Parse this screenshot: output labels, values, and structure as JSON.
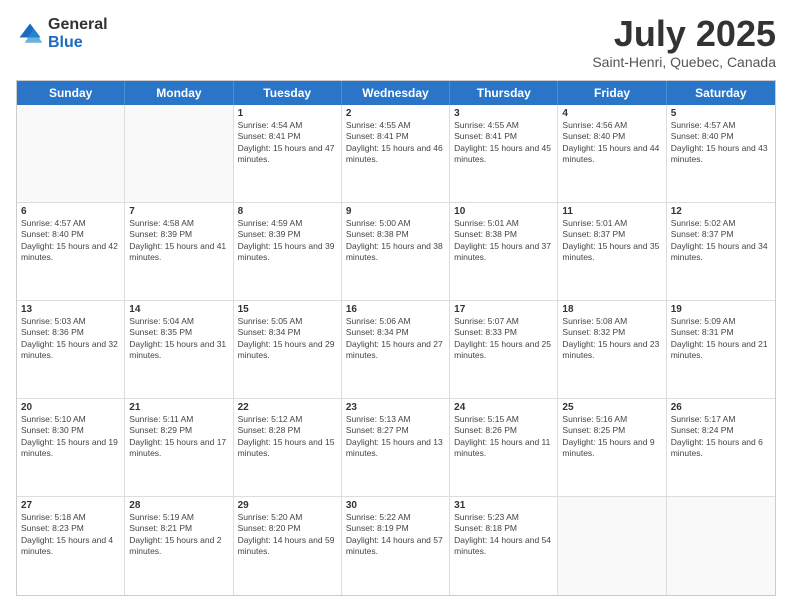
{
  "logo": {
    "general": "General",
    "blue": "Blue"
  },
  "title": "July 2025",
  "location": "Saint-Henri, Quebec, Canada",
  "header_days": [
    "Sunday",
    "Monday",
    "Tuesday",
    "Wednesday",
    "Thursday",
    "Friday",
    "Saturday"
  ],
  "weeks": [
    [
      {
        "day": "",
        "sunrise": "",
        "sunset": "",
        "daylight": ""
      },
      {
        "day": "",
        "sunrise": "",
        "sunset": "",
        "daylight": ""
      },
      {
        "day": "1",
        "sunrise": "Sunrise: 4:54 AM",
        "sunset": "Sunset: 8:41 PM",
        "daylight": "Daylight: 15 hours and 47 minutes."
      },
      {
        "day": "2",
        "sunrise": "Sunrise: 4:55 AM",
        "sunset": "Sunset: 8:41 PM",
        "daylight": "Daylight: 15 hours and 46 minutes."
      },
      {
        "day": "3",
        "sunrise": "Sunrise: 4:55 AM",
        "sunset": "Sunset: 8:41 PM",
        "daylight": "Daylight: 15 hours and 45 minutes."
      },
      {
        "day": "4",
        "sunrise": "Sunrise: 4:56 AM",
        "sunset": "Sunset: 8:40 PM",
        "daylight": "Daylight: 15 hours and 44 minutes."
      },
      {
        "day": "5",
        "sunrise": "Sunrise: 4:57 AM",
        "sunset": "Sunset: 8:40 PM",
        "daylight": "Daylight: 15 hours and 43 minutes."
      }
    ],
    [
      {
        "day": "6",
        "sunrise": "Sunrise: 4:57 AM",
        "sunset": "Sunset: 8:40 PM",
        "daylight": "Daylight: 15 hours and 42 minutes."
      },
      {
        "day": "7",
        "sunrise": "Sunrise: 4:58 AM",
        "sunset": "Sunset: 8:39 PM",
        "daylight": "Daylight: 15 hours and 41 minutes."
      },
      {
        "day": "8",
        "sunrise": "Sunrise: 4:59 AM",
        "sunset": "Sunset: 8:39 PM",
        "daylight": "Daylight: 15 hours and 39 minutes."
      },
      {
        "day": "9",
        "sunrise": "Sunrise: 5:00 AM",
        "sunset": "Sunset: 8:38 PM",
        "daylight": "Daylight: 15 hours and 38 minutes."
      },
      {
        "day": "10",
        "sunrise": "Sunrise: 5:01 AM",
        "sunset": "Sunset: 8:38 PM",
        "daylight": "Daylight: 15 hours and 37 minutes."
      },
      {
        "day": "11",
        "sunrise": "Sunrise: 5:01 AM",
        "sunset": "Sunset: 8:37 PM",
        "daylight": "Daylight: 15 hours and 35 minutes."
      },
      {
        "day": "12",
        "sunrise": "Sunrise: 5:02 AM",
        "sunset": "Sunset: 8:37 PM",
        "daylight": "Daylight: 15 hours and 34 minutes."
      }
    ],
    [
      {
        "day": "13",
        "sunrise": "Sunrise: 5:03 AM",
        "sunset": "Sunset: 8:36 PM",
        "daylight": "Daylight: 15 hours and 32 minutes."
      },
      {
        "day": "14",
        "sunrise": "Sunrise: 5:04 AM",
        "sunset": "Sunset: 8:35 PM",
        "daylight": "Daylight: 15 hours and 31 minutes."
      },
      {
        "day": "15",
        "sunrise": "Sunrise: 5:05 AM",
        "sunset": "Sunset: 8:34 PM",
        "daylight": "Daylight: 15 hours and 29 minutes."
      },
      {
        "day": "16",
        "sunrise": "Sunrise: 5:06 AM",
        "sunset": "Sunset: 8:34 PM",
        "daylight": "Daylight: 15 hours and 27 minutes."
      },
      {
        "day": "17",
        "sunrise": "Sunrise: 5:07 AM",
        "sunset": "Sunset: 8:33 PM",
        "daylight": "Daylight: 15 hours and 25 minutes."
      },
      {
        "day": "18",
        "sunrise": "Sunrise: 5:08 AM",
        "sunset": "Sunset: 8:32 PM",
        "daylight": "Daylight: 15 hours and 23 minutes."
      },
      {
        "day": "19",
        "sunrise": "Sunrise: 5:09 AM",
        "sunset": "Sunset: 8:31 PM",
        "daylight": "Daylight: 15 hours and 21 minutes."
      }
    ],
    [
      {
        "day": "20",
        "sunrise": "Sunrise: 5:10 AM",
        "sunset": "Sunset: 8:30 PM",
        "daylight": "Daylight: 15 hours and 19 minutes."
      },
      {
        "day": "21",
        "sunrise": "Sunrise: 5:11 AM",
        "sunset": "Sunset: 8:29 PM",
        "daylight": "Daylight: 15 hours and 17 minutes."
      },
      {
        "day": "22",
        "sunrise": "Sunrise: 5:12 AM",
        "sunset": "Sunset: 8:28 PM",
        "daylight": "Daylight: 15 hours and 15 minutes."
      },
      {
        "day": "23",
        "sunrise": "Sunrise: 5:13 AM",
        "sunset": "Sunset: 8:27 PM",
        "daylight": "Daylight: 15 hours and 13 minutes."
      },
      {
        "day": "24",
        "sunrise": "Sunrise: 5:15 AM",
        "sunset": "Sunset: 8:26 PM",
        "daylight": "Daylight: 15 hours and 11 minutes."
      },
      {
        "day": "25",
        "sunrise": "Sunrise: 5:16 AM",
        "sunset": "Sunset: 8:25 PM",
        "daylight": "Daylight: 15 hours and 9 minutes."
      },
      {
        "day": "26",
        "sunrise": "Sunrise: 5:17 AM",
        "sunset": "Sunset: 8:24 PM",
        "daylight": "Daylight: 15 hours and 6 minutes."
      }
    ],
    [
      {
        "day": "27",
        "sunrise": "Sunrise: 5:18 AM",
        "sunset": "Sunset: 8:23 PM",
        "daylight": "Daylight: 15 hours and 4 minutes."
      },
      {
        "day": "28",
        "sunrise": "Sunrise: 5:19 AM",
        "sunset": "Sunset: 8:21 PM",
        "daylight": "Daylight: 15 hours and 2 minutes."
      },
      {
        "day": "29",
        "sunrise": "Sunrise: 5:20 AM",
        "sunset": "Sunset: 8:20 PM",
        "daylight": "Daylight: 14 hours and 59 minutes."
      },
      {
        "day": "30",
        "sunrise": "Sunrise: 5:22 AM",
        "sunset": "Sunset: 8:19 PM",
        "daylight": "Daylight: 14 hours and 57 minutes."
      },
      {
        "day": "31",
        "sunrise": "Sunrise: 5:23 AM",
        "sunset": "Sunset: 8:18 PM",
        "daylight": "Daylight: 14 hours and 54 minutes."
      },
      {
        "day": "",
        "sunrise": "",
        "sunset": "",
        "daylight": ""
      },
      {
        "day": "",
        "sunrise": "",
        "sunset": "",
        "daylight": ""
      }
    ]
  ]
}
